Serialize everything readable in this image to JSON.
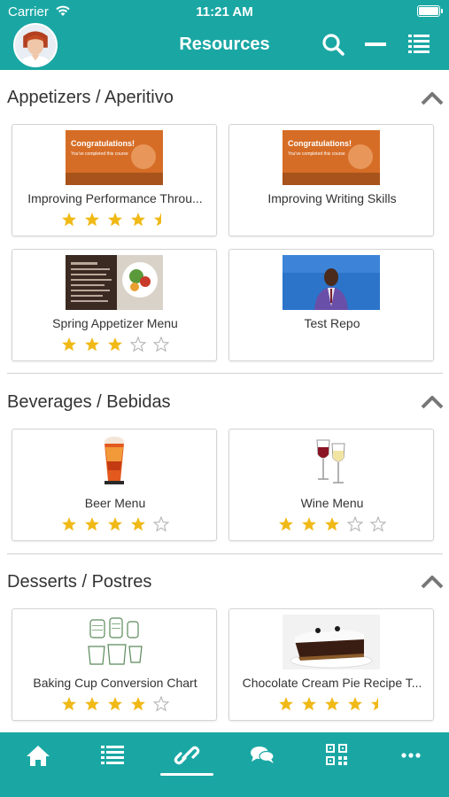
{
  "status": {
    "carrier": "Carrier",
    "time": "11:21 AM"
  },
  "header": {
    "title": "Resources",
    "icons": [
      "avatar",
      "search-icon",
      "minus-icon",
      "list-icon"
    ]
  },
  "sections": [
    {
      "title": "Appetizers /  Aperitivo",
      "items": [
        {
          "title": "Improving Performance Throu...",
          "rating": 4.5,
          "thumb": "congratulations-slide"
        },
        {
          "title": "Improving Writing Skills",
          "rating": null,
          "thumb": "congratulations-slide"
        },
        {
          "title": "Spring Appetizer Menu",
          "rating": 3,
          "thumb": "appetizer-menu-photo"
        },
        {
          "title": "Test Repo",
          "rating": null,
          "thumb": "presenter-video"
        }
      ]
    },
    {
      "title": "Beverages /  Bebidas",
      "items": [
        {
          "title": "Beer Menu",
          "rating": 4,
          "thumb": "beer-glass"
        },
        {
          "title": "Wine Menu",
          "rating": 3,
          "thumb": "wine-glasses"
        }
      ]
    },
    {
      "title": "Desserts / Postres",
      "items": [
        {
          "title": "Baking Cup Conversion Chart",
          "rating": 4,
          "thumb": "measuring-cups"
        },
        {
          "title": "Chocolate Cream Pie Recipe T...",
          "rating": 4.5,
          "thumb": "chocolate-pie"
        }
      ]
    }
  ],
  "thumb_text": {
    "congrats_title": "Congratulations!",
    "congrats_sub": "You've completed this course"
  },
  "tabbar": {
    "tabs": [
      "home-icon",
      "list-icon",
      "link-icon",
      "chat-icon",
      "qr-code-icon",
      "more-icon"
    ],
    "active": "link-icon"
  },
  "colors": {
    "accent": "#1aa7a4",
    "star": "#f0b917",
    "star_empty": "#b5b5b5"
  }
}
